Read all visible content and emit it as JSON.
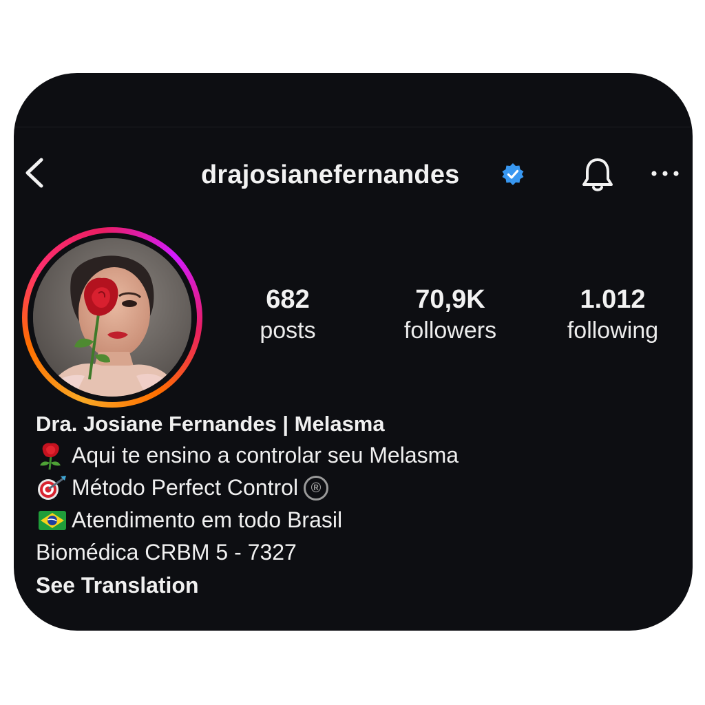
{
  "header": {
    "username": "drajosianefernandes",
    "verified_color": "#3897f0",
    "icons": [
      "back-chevron-icon",
      "verified-badge-icon",
      "bell-icon",
      "more-horizontal-icon"
    ]
  },
  "stats": {
    "posts_count": "682",
    "posts_label": "posts",
    "followers_count": "70,9K",
    "followers_label": "followers",
    "following_count": "1.012",
    "following_label": "following"
  },
  "bio": {
    "name": "Dra. Josiane Fernandes | Melasma",
    "line1": "Aqui te ensino a controlar seu Melasma",
    "line2": "Método Perfect Control",
    "line2_mark": "®",
    "line3": "Atendimento em todo Brasil",
    "line4": "Biomédica CRBM 5 - 7327",
    "see_translation": "See Translation",
    "emojis": [
      "rose-emoji",
      "target-dart-emoji",
      "brazil-flag-emoji"
    ]
  },
  "colors": {
    "background": "#0d0e12",
    "text": "#f2f2f2",
    "story_ring": [
      "#f9a825",
      "#ff6f00",
      "#e91e63",
      "#d21cff"
    ]
  }
}
